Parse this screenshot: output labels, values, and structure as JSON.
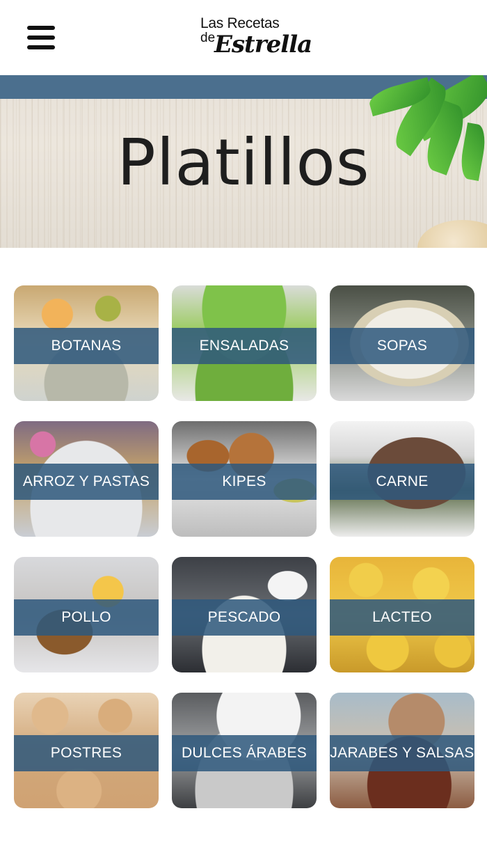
{
  "header": {
    "menu_icon": "hamburger-menu-icon",
    "logo": {
      "line1": "Las Recetas",
      "line2": "de",
      "line3": "Estrella"
    }
  },
  "banner": {
    "title": "Platillos",
    "strip_color": "#4b6f8e"
  },
  "categories": [
    {
      "label": "BOTANAS"
    },
    {
      "label": "ENSALADAS"
    },
    {
      "label": "SOPAS"
    },
    {
      "label": "ARROZ Y PASTAS"
    },
    {
      "label": "KIPES"
    },
    {
      "label": "CARNE"
    },
    {
      "label": "POLLO"
    },
    {
      "label": "PESCADO"
    },
    {
      "label": "LACTEO"
    },
    {
      "label": "POSTRES"
    },
    {
      "label": "DULCES ÁRABES"
    },
    {
      "label": "JARABES Y SALSAS"
    }
  ],
  "colors": {
    "label_band": "#2f587d",
    "label_text": "#ffffff"
  }
}
